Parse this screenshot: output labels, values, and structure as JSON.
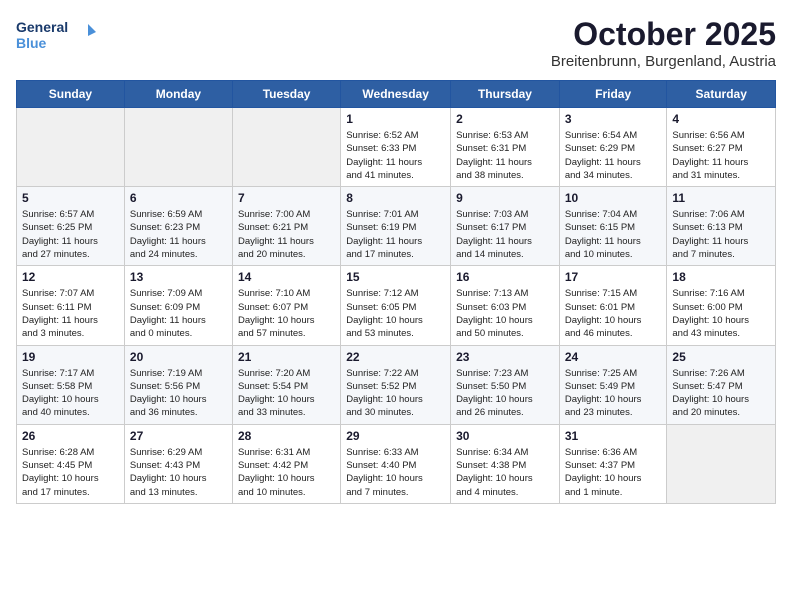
{
  "logo": {
    "line1": "General",
    "line2": "Blue"
  },
  "title": "October 2025",
  "subtitle": "Breitenbrunn, Burgenland, Austria",
  "weekdays": [
    "Sunday",
    "Monday",
    "Tuesday",
    "Wednesday",
    "Thursday",
    "Friday",
    "Saturday"
  ],
  "weeks": [
    [
      {
        "day": "",
        "info": ""
      },
      {
        "day": "",
        "info": ""
      },
      {
        "day": "",
        "info": ""
      },
      {
        "day": "1",
        "info": "Sunrise: 6:52 AM\nSunset: 6:33 PM\nDaylight: 11 hours\nand 41 minutes."
      },
      {
        "day": "2",
        "info": "Sunrise: 6:53 AM\nSunset: 6:31 PM\nDaylight: 11 hours\nand 38 minutes."
      },
      {
        "day": "3",
        "info": "Sunrise: 6:54 AM\nSunset: 6:29 PM\nDaylight: 11 hours\nand 34 minutes."
      },
      {
        "day": "4",
        "info": "Sunrise: 6:56 AM\nSunset: 6:27 PM\nDaylight: 11 hours\nand 31 minutes."
      }
    ],
    [
      {
        "day": "5",
        "info": "Sunrise: 6:57 AM\nSunset: 6:25 PM\nDaylight: 11 hours\nand 27 minutes."
      },
      {
        "day": "6",
        "info": "Sunrise: 6:59 AM\nSunset: 6:23 PM\nDaylight: 11 hours\nand 24 minutes."
      },
      {
        "day": "7",
        "info": "Sunrise: 7:00 AM\nSunset: 6:21 PM\nDaylight: 11 hours\nand 20 minutes."
      },
      {
        "day": "8",
        "info": "Sunrise: 7:01 AM\nSunset: 6:19 PM\nDaylight: 11 hours\nand 17 minutes."
      },
      {
        "day": "9",
        "info": "Sunrise: 7:03 AM\nSunset: 6:17 PM\nDaylight: 11 hours\nand 14 minutes."
      },
      {
        "day": "10",
        "info": "Sunrise: 7:04 AM\nSunset: 6:15 PM\nDaylight: 11 hours\nand 10 minutes."
      },
      {
        "day": "11",
        "info": "Sunrise: 7:06 AM\nSunset: 6:13 PM\nDaylight: 11 hours\nand 7 minutes."
      }
    ],
    [
      {
        "day": "12",
        "info": "Sunrise: 7:07 AM\nSunset: 6:11 PM\nDaylight: 11 hours\nand 3 minutes."
      },
      {
        "day": "13",
        "info": "Sunrise: 7:09 AM\nSunset: 6:09 PM\nDaylight: 11 hours\nand 0 minutes."
      },
      {
        "day": "14",
        "info": "Sunrise: 7:10 AM\nSunset: 6:07 PM\nDaylight: 10 hours\nand 57 minutes."
      },
      {
        "day": "15",
        "info": "Sunrise: 7:12 AM\nSunset: 6:05 PM\nDaylight: 10 hours\nand 53 minutes."
      },
      {
        "day": "16",
        "info": "Sunrise: 7:13 AM\nSunset: 6:03 PM\nDaylight: 10 hours\nand 50 minutes."
      },
      {
        "day": "17",
        "info": "Sunrise: 7:15 AM\nSunset: 6:01 PM\nDaylight: 10 hours\nand 46 minutes."
      },
      {
        "day": "18",
        "info": "Sunrise: 7:16 AM\nSunset: 6:00 PM\nDaylight: 10 hours\nand 43 minutes."
      }
    ],
    [
      {
        "day": "19",
        "info": "Sunrise: 7:17 AM\nSunset: 5:58 PM\nDaylight: 10 hours\nand 40 minutes."
      },
      {
        "day": "20",
        "info": "Sunrise: 7:19 AM\nSunset: 5:56 PM\nDaylight: 10 hours\nand 36 minutes."
      },
      {
        "day": "21",
        "info": "Sunrise: 7:20 AM\nSunset: 5:54 PM\nDaylight: 10 hours\nand 33 minutes."
      },
      {
        "day": "22",
        "info": "Sunrise: 7:22 AM\nSunset: 5:52 PM\nDaylight: 10 hours\nand 30 minutes."
      },
      {
        "day": "23",
        "info": "Sunrise: 7:23 AM\nSunset: 5:50 PM\nDaylight: 10 hours\nand 26 minutes."
      },
      {
        "day": "24",
        "info": "Sunrise: 7:25 AM\nSunset: 5:49 PM\nDaylight: 10 hours\nand 23 minutes."
      },
      {
        "day": "25",
        "info": "Sunrise: 7:26 AM\nSunset: 5:47 PM\nDaylight: 10 hours\nand 20 minutes."
      }
    ],
    [
      {
        "day": "26",
        "info": "Sunrise: 6:28 AM\nSunset: 4:45 PM\nDaylight: 10 hours\nand 17 minutes."
      },
      {
        "day": "27",
        "info": "Sunrise: 6:29 AM\nSunset: 4:43 PM\nDaylight: 10 hours\nand 13 minutes."
      },
      {
        "day": "28",
        "info": "Sunrise: 6:31 AM\nSunset: 4:42 PM\nDaylight: 10 hours\nand 10 minutes."
      },
      {
        "day": "29",
        "info": "Sunrise: 6:33 AM\nSunset: 4:40 PM\nDaylight: 10 hours\nand 7 minutes."
      },
      {
        "day": "30",
        "info": "Sunrise: 6:34 AM\nSunset: 4:38 PM\nDaylight: 10 hours\nand 4 minutes."
      },
      {
        "day": "31",
        "info": "Sunrise: 6:36 AM\nSunset: 4:37 PM\nDaylight: 10 hours\nand 1 minute."
      },
      {
        "day": "",
        "info": ""
      }
    ]
  ]
}
